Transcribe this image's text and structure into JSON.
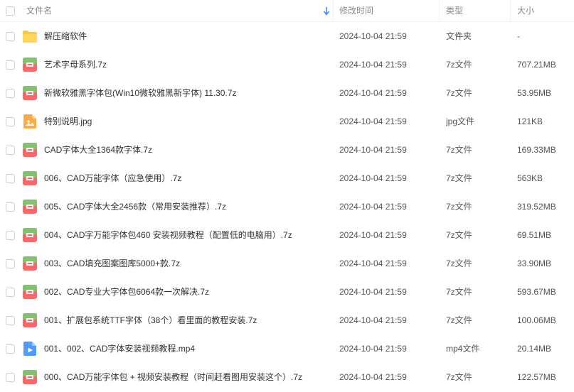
{
  "header": {
    "name": "文件名",
    "modified": "修改时间",
    "type": "类型",
    "size": "大小"
  },
  "colors": {
    "accent": "#3b8cff",
    "archive_top": "#7fc36b",
    "archive_bottom": "#f56b6b",
    "folder": "#ffc933",
    "image": "#ffab4a",
    "video": "#4f9bff"
  },
  "files": [
    {
      "name": "解压缩软件",
      "time": "2024-10-04 21:59",
      "type": "文件夹",
      "size": "-",
      "icon": "folder-icon"
    },
    {
      "name": "艺术字母系列.7z",
      "time": "2024-10-04 21:59",
      "type": "7z文件",
      "size": "707.21MB",
      "icon": "archive-icon"
    },
    {
      "name": "新微软雅黑字体包(Win10微软雅黑新字体) 11.30.7z",
      "time": "2024-10-04 21:59",
      "type": "7z文件",
      "size": "53.95MB",
      "icon": "archive-icon"
    },
    {
      "name": "特别说明.jpg",
      "time": "2024-10-04 21:59",
      "type": "jpg文件",
      "size": "121KB",
      "icon": "image-icon"
    },
    {
      "name": "CAD字体大全1364款字体.7z",
      "time": "2024-10-04 21:59",
      "type": "7z文件",
      "size": "169.33MB",
      "icon": "archive-icon"
    },
    {
      "name": "006、CAD万能字体（应急使用）.7z",
      "time": "2024-10-04 21:59",
      "type": "7z文件",
      "size": "563KB",
      "icon": "archive-icon"
    },
    {
      "name": "005、CAD字体大全2456款（常用安装推荐）.7z",
      "time": "2024-10-04 21:59",
      "type": "7z文件",
      "size": "319.52MB",
      "icon": "archive-icon"
    },
    {
      "name": "004、CAD字万能字体包460 安装视频教程（配置低的电脑用）.7z",
      "time": "2024-10-04 21:59",
      "type": "7z文件",
      "size": "69.51MB",
      "icon": "archive-icon"
    },
    {
      "name": "003、CAD填充图案图库5000+款.7z",
      "time": "2024-10-04 21:59",
      "type": "7z文件",
      "size": "33.90MB",
      "icon": "archive-icon"
    },
    {
      "name": "002、CAD专业大字体包6064款一次解决.7z",
      "time": "2024-10-04 21:59",
      "type": "7z文件",
      "size": "593.67MB",
      "icon": "archive-icon"
    },
    {
      "name": "001、扩展包系统TTF字体（38个）看里面的教程安装.7z",
      "time": "2024-10-04 21:59",
      "type": "7z文件",
      "size": "100.06MB",
      "icon": "archive-icon"
    },
    {
      "name": "001、002、CAD字体安装视频教程.mp4",
      "time": "2024-10-04 21:59",
      "type": "mp4文件",
      "size": "20.14MB",
      "icon": "video-icon"
    },
    {
      "name": "000、CAD万能字体包 + 视频安装教程（时间赶看图用安装这个）.7z",
      "time": "2024-10-04 21:59",
      "type": "7z文件",
      "size": "122.57MB",
      "icon": "archive-icon"
    }
  ]
}
